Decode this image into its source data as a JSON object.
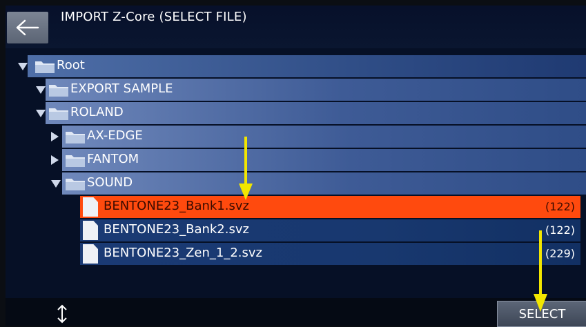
{
  "header": {
    "title": "IMPORT Z-Core (SELECT FILE)",
    "back_icon": "back-arrow-icon"
  },
  "tree": {
    "folders": [
      {
        "label": "Root",
        "expanded": true
      },
      {
        "label": "EXPORT SAMPLE",
        "expanded": true
      },
      {
        "label": "ROLAND",
        "expanded": true
      },
      {
        "label": "AX-EDGE",
        "expanded": false
      },
      {
        "label": "FANTOM",
        "expanded": false
      },
      {
        "label": "SOUND",
        "expanded": true
      }
    ],
    "files": [
      {
        "name": "BENTONE23_Bank1.svz",
        "count": "(122)",
        "selected": true
      },
      {
        "name": "BENTONE23_Bank2.svz",
        "count": "(122)",
        "selected": false
      },
      {
        "name": "BENTONE23_Zen_1_2.svz",
        "count": "(229)",
        "selected": false
      }
    ]
  },
  "footer": {
    "select_label": "SELECT",
    "scroll_icon": "up-down-arrow-icon"
  },
  "colors": {
    "selected": "#ff4a0e",
    "annotation": "#f2e600",
    "background": "#061026"
  }
}
